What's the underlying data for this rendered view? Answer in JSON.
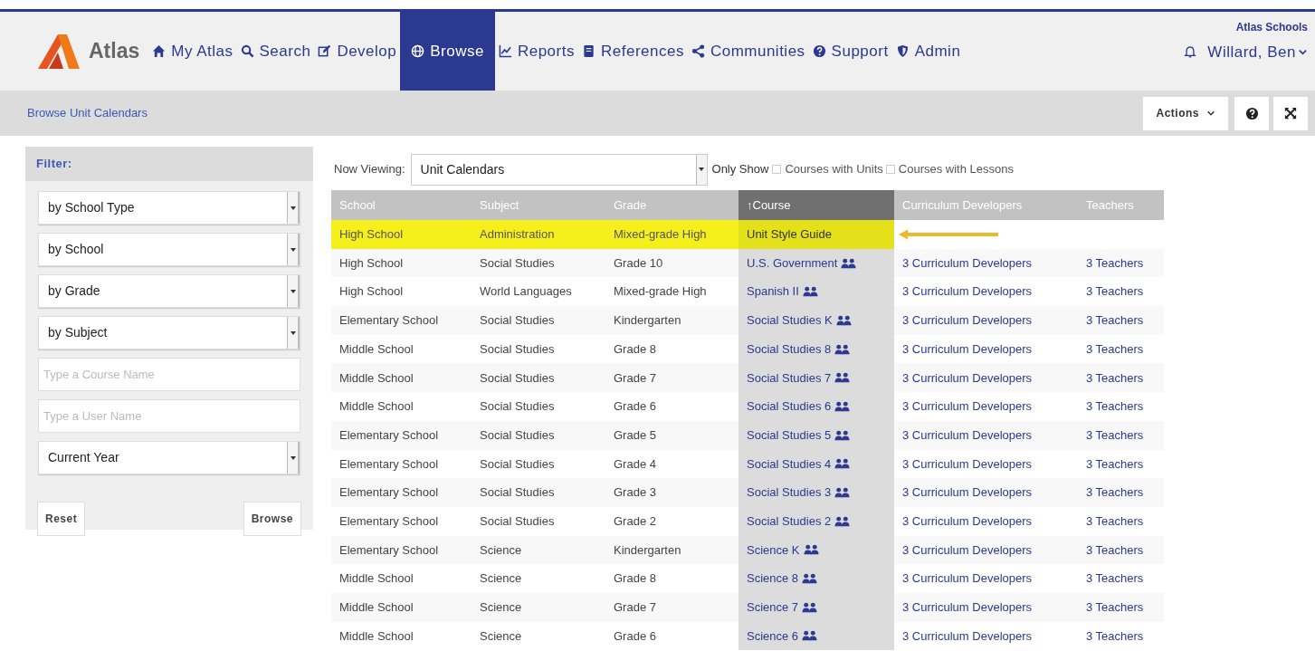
{
  "header": {
    "logo_text": "Atlas",
    "nav": [
      {
        "label": "My Atlas",
        "selected": false
      },
      {
        "label": "Search",
        "selected": false
      },
      {
        "label": "Develop",
        "selected": false
      },
      {
        "label": "Browse",
        "selected": true
      },
      {
        "label": "Reports",
        "selected": false
      },
      {
        "label": "References",
        "selected": false
      },
      {
        "label": "Communities",
        "selected": false
      },
      {
        "label": "Support",
        "selected": false
      },
      {
        "label": "Admin",
        "selected": false
      }
    ],
    "org": "Atlas Schools",
    "user": "Willard, Ben"
  },
  "breadcrumb": "Browse Unit Calendars",
  "actions_button": "Actions",
  "filter": {
    "title": "Filter:",
    "controls": [
      {
        "kind": "select",
        "value": "by School Type"
      },
      {
        "kind": "select",
        "value": "by School"
      },
      {
        "kind": "select",
        "value": "by Grade"
      },
      {
        "kind": "select",
        "value": "by Subject"
      },
      {
        "kind": "input",
        "placeholder": "Type a Course Name"
      },
      {
        "kind": "input",
        "placeholder": "Type a User Name"
      },
      {
        "kind": "select",
        "value": "Current Year"
      }
    ],
    "buttons": [
      "Reset",
      "Browse"
    ]
  },
  "toolbar": {
    "now_viewing_label": "Now Viewing:",
    "now_viewing": "Unit Calendars",
    "only_show_label": "Only Show",
    "checkboxes": [
      {
        "label": "Courses with Units",
        "checked": false
      },
      {
        "label": "Courses with Lessons",
        "checked": false
      }
    ]
  },
  "table": {
    "columns": [
      {
        "label": "School",
        "sorted": false
      },
      {
        "label": "Subject",
        "sorted": false
      },
      {
        "label": "Grade",
        "sorted": false
      },
      {
        "label": "↑Course",
        "sorted": true
      },
      {
        "label": "Curriculum Developers",
        "sorted": false
      },
      {
        "label": "Teachers",
        "sorted": false
      }
    ],
    "rows": [
      {
        "school": "High School",
        "subject": "Administration",
        "grade": "Mixed-grade High",
        "course": "Unit Style Guide",
        "group_icon": false,
        "highlighted": true
      },
      {
        "school": "High School",
        "subject": "Social Studies",
        "grade": "Grade 10",
        "course": "U.S. Government",
        "group_icon": true,
        "highlighted": false,
        "developers": "3 Curriculum Developers",
        "teachers": "3 Teachers"
      },
      {
        "school": "High School",
        "subject": "World Languages",
        "grade": "Mixed-grade High",
        "course": "Spanish II",
        "group_icon": true,
        "highlighted": false,
        "developers": "3 Curriculum Developers",
        "teachers": "3 Teachers"
      },
      {
        "school": "Elementary School",
        "subject": "Social Studies",
        "grade": "Kindergarten",
        "course": "Social Studies K",
        "group_icon": true,
        "highlighted": false,
        "developers": "3 Curriculum Developers",
        "teachers": "3 Teachers"
      },
      {
        "school": "Middle School",
        "subject": "Social Studies",
        "grade": "Grade 8",
        "course": "Social Studies 8",
        "group_icon": true,
        "highlighted": false,
        "developers": "3 Curriculum Developers",
        "teachers": "3 Teachers"
      },
      {
        "school": "Middle School",
        "subject": "Social Studies",
        "grade": "Grade 7",
        "course": "Social Studies 7",
        "group_icon": true,
        "highlighted": false,
        "developers": "3 Curriculum Developers",
        "teachers": "3 Teachers"
      },
      {
        "school": "Middle School",
        "subject": "Social Studies",
        "grade": "Grade 6",
        "course": "Social Studies 6",
        "group_icon": true,
        "highlighted": false,
        "developers": "3 Curriculum Developers",
        "teachers": "3 Teachers"
      },
      {
        "school": "Elementary School",
        "subject": "Social Studies",
        "grade": "Grade 5",
        "course": "Social Studies 5",
        "group_icon": true,
        "highlighted": false,
        "developers": "3 Curriculum Developers",
        "teachers": "3 Teachers"
      },
      {
        "school": "Elementary School",
        "subject": "Social Studies",
        "grade": "Grade 4",
        "course": "Social Studies 4",
        "group_icon": true,
        "highlighted": false,
        "developers": "3 Curriculum Developers",
        "teachers": "3 Teachers"
      },
      {
        "school": "Elementary School",
        "subject": "Social Studies",
        "grade": "Grade 3",
        "course": "Social Studies 3",
        "group_icon": true,
        "highlighted": false,
        "developers": "3 Curriculum Developers",
        "teachers": "3 Teachers"
      },
      {
        "school": "Elementary School",
        "subject": "Social Studies",
        "grade": "Grade 2",
        "course": "Social Studies 2",
        "group_icon": true,
        "highlighted": false,
        "developers": "3 Curriculum Developers",
        "teachers": "3 Teachers"
      },
      {
        "school": "Elementary School",
        "subject": "Science",
        "grade": "Kindergarten",
        "course": "Science K",
        "group_icon": true,
        "highlighted": false,
        "developers": "3 Curriculum Developers",
        "teachers": "3 Teachers"
      },
      {
        "school": "Middle School",
        "subject": "Science",
        "grade": "Grade 8",
        "course": "Science 8",
        "group_icon": true,
        "highlighted": false,
        "developers": "3 Curriculum Developers",
        "teachers": "3 Teachers"
      },
      {
        "school": "Middle School",
        "subject": "Science",
        "grade": "Grade 7",
        "course": "Science 7",
        "group_icon": true,
        "highlighted": false,
        "developers": "3 Curriculum Developers",
        "teachers": "3 Teachers"
      },
      {
        "school": "Middle School",
        "subject": "Science",
        "grade": "Grade 6",
        "course": "Science 6",
        "group_icon": true,
        "highlighted": false,
        "developers": "3 Curriculum Developers",
        "teachers": "3 Teachers"
      }
    ]
  }
}
